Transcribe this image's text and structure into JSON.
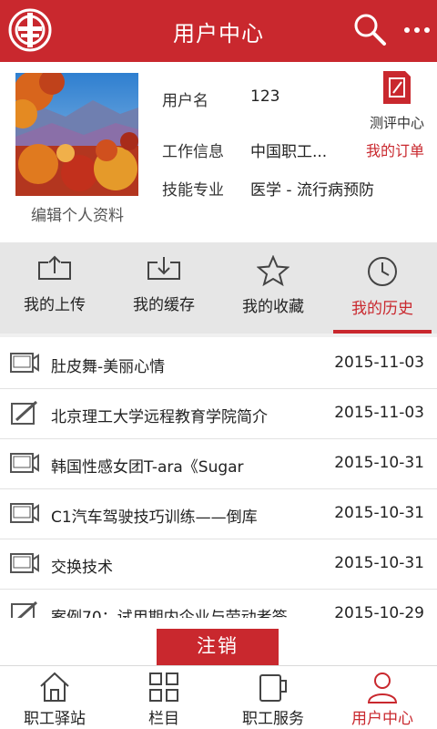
{
  "header": {
    "title": "用户中心",
    "logo_icon": "union-logo-icon",
    "search_icon": "search-icon",
    "more_icon": "more-icon",
    "color": "#c9282e"
  },
  "profile": {
    "edit_label": "编辑个人资料",
    "fields": [
      {
        "label": "用户名",
        "value": "123"
      },
      {
        "label": "工作信息",
        "value": "中国职工..."
      },
      {
        "label": "技能专业",
        "value": "医学 - 流行病预防"
      }
    ],
    "eval_center": "测评中心",
    "my_orders": "我的订单"
  },
  "tabs": [
    {
      "label": "我的上传",
      "icon": "upload-icon",
      "active": false
    },
    {
      "label": "我的缓存",
      "icon": "download-icon",
      "active": false
    },
    {
      "label": "我的收藏",
      "icon": "star-icon",
      "active": false
    },
    {
      "label": "我的历史",
      "icon": "clock-icon",
      "active": true
    }
  ],
  "history": [
    {
      "icon": "video-icon",
      "title": "肚皮舞-美丽心情",
      "date": "2015-11-03"
    },
    {
      "icon": "document-icon",
      "title": "北京理工大学远程教育学院简介",
      "date": "2015-11-03"
    },
    {
      "icon": "video-icon",
      "title": "韩国性感女团T-ara《Sugar",
      "date": "2015-10-31"
    },
    {
      "icon": "video-icon",
      "title": "C1汽车驾驶技巧训练——倒库",
      "date": "2015-10-31"
    },
    {
      "icon": "video-icon",
      "title": "交换技术",
      "date": "2015-10-31"
    },
    {
      "icon": "document-icon",
      "title": "案例70：试用期内企业与劳动者签",
      "date": "2015-10-29"
    }
  ],
  "logout_label": "注销",
  "bottom_nav": [
    {
      "label": "职工驿站",
      "icon": "house-icon",
      "active": false
    },
    {
      "label": "栏目",
      "icon": "grid-icon",
      "active": false
    },
    {
      "label": "职工服务",
      "icon": "cup-icon",
      "active": false
    },
    {
      "label": "用户中心",
      "icon": "user-icon",
      "active": true
    }
  ]
}
